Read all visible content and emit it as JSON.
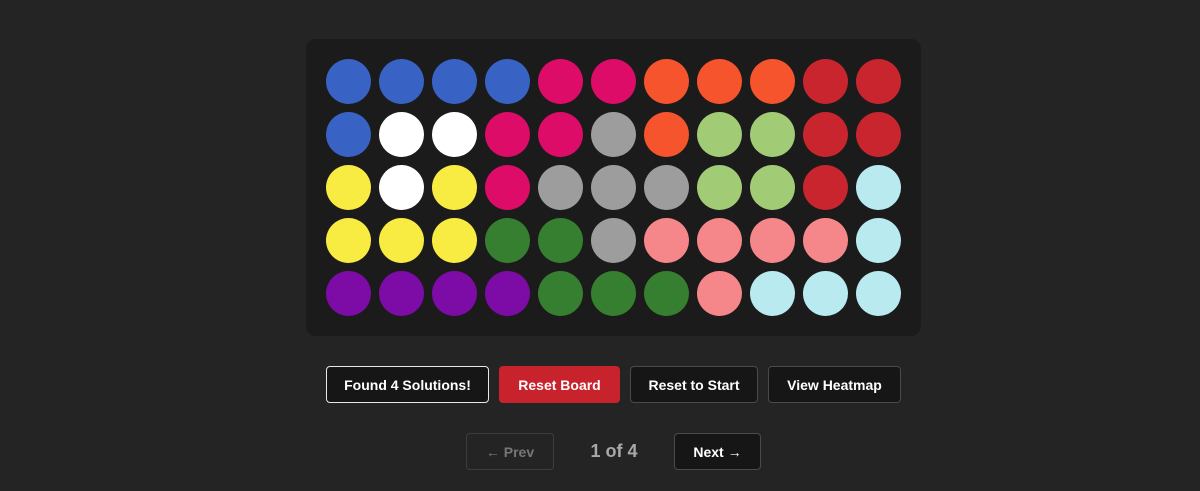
{
  "board": {
    "rows": [
      [
        "blue",
        "blue",
        "blue",
        "blue",
        "magenta",
        "magenta",
        "orange",
        "orange",
        "orange",
        "red",
        "red"
      ],
      [
        "blue",
        "white",
        "white",
        "magenta",
        "magenta",
        "gray",
        "orange",
        "lightgreen",
        "lightgreen",
        "red",
        "red"
      ],
      [
        "yellow",
        "white",
        "yellow",
        "magenta",
        "gray",
        "gray",
        "gray",
        "lightgreen",
        "lightgreen",
        "red",
        "cyan"
      ],
      [
        "yellow",
        "yellow",
        "yellow",
        "green",
        "green",
        "gray",
        "pink",
        "pink",
        "pink",
        "pink",
        "cyan"
      ],
      [
        "purple",
        "purple",
        "purple",
        "purple",
        "green",
        "green",
        "green",
        "pink",
        "cyan",
        "cyan",
        "cyan"
      ]
    ],
    "colors": {
      "blue": "#3862c4",
      "magenta": "#dc0c68",
      "orange": "#f5542c",
      "red": "#c9252f",
      "white": "#ffffff",
      "gray": "#9d9d9d",
      "lightgreen": "#a2cb76",
      "yellow": "#f8ec43",
      "cyan": "#b8eaf0",
      "green": "#367f31",
      "pink": "#f5878a",
      "purple": "#7d0ba6"
    }
  },
  "actions": {
    "found_label": "Found 4 Solutions!",
    "reset_board_label": "Reset Board",
    "reset_start_label": "Reset to Start",
    "heatmap_label": "View Heatmap"
  },
  "pager": {
    "prev_label": "← Prev",
    "indicator": "1 of 4",
    "next_label": "Next →"
  }
}
